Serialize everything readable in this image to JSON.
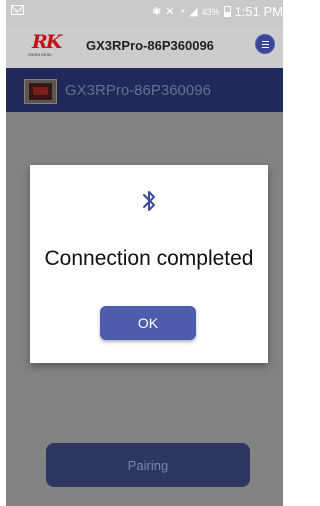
{
  "status_bar": {
    "battery_percent": "43%",
    "time": "1:51 PM"
  },
  "header": {
    "logo_text": "RK",
    "logo_subtext": "RIKEN KEIKI",
    "title": "GX3RPro-86P360096",
    "menu_icon": "menu-icon"
  },
  "device": {
    "name": "GX3RPro-86P360096"
  },
  "dialog": {
    "icon": "bluetooth-icon",
    "message": "Connection completed",
    "ok_label": "OK"
  },
  "pairing_label": "Pairing",
  "colors": {
    "accent": "#4f5bad",
    "device_bar": "#1f2a5a",
    "bluetooth": "#3a4a9e",
    "logo_red": "#c2101c"
  }
}
